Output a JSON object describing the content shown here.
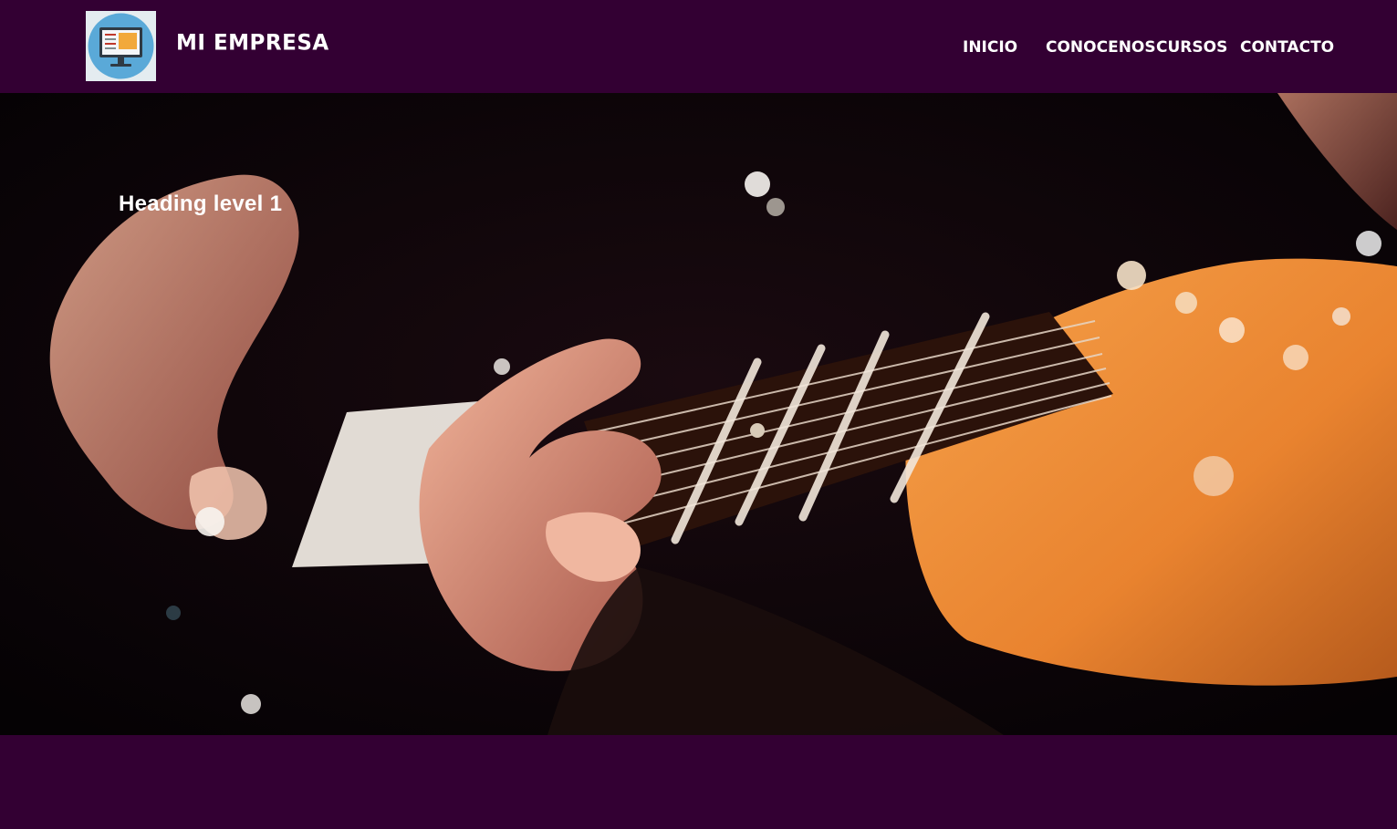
{
  "header": {
    "brand": "MI EMPRESA",
    "logo_icon": "computer-monitor-icon"
  },
  "nav": {
    "items": [
      {
        "label": "INICIO"
      },
      {
        "label": "CONOCENOS"
      },
      {
        "label": "CURSOS"
      },
      {
        "label": "CONTACTO"
      }
    ]
  },
  "hero": {
    "heading": "Heading level 1"
  },
  "colors": {
    "background": "#330033",
    "text": "#ffffff",
    "logo_circle": "#5aa9d8",
    "logo_screen": "#f2a93b"
  }
}
